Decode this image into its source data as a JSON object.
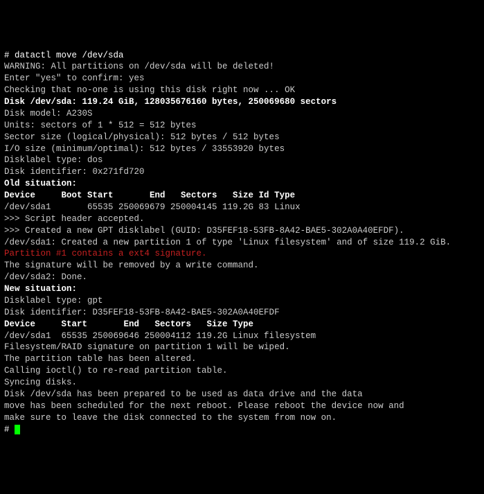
{
  "lines": [
    {
      "text": "# datactl move /dev/sda",
      "cls": "white"
    },
    {
      "text": "WARNING: All partitions on /dev/sda will be deleted!",
      "cls": ""
    },
    {
      "text": "Enter \"yes\" to confirm: yes",
      "cls": ""
    },
    {
      "text": "Checking that no-one is using this disk right now ... OK",
      "cls": ""
    },
    {
      "text": "",
      "cls": ""
    },
    {
      "text": "Disk /dev/sda: 119.24 GiB, 128035676160 bytes, 250069680 sectors",
      "cls": "white bold"
    },
    {
      "text": "Disk model: A230S",
      "cls": ""
    },
    {
      "text": "Units: sectors of 1 * 512 = 512 bytes",
      "cls": ""
    },
    {
      "text": "Sector size (logical/physical): 512 bytes / 512 bytes",
      "cls": ""
    },
    {
      "text": "I/O size (minimum/optimal): 512 bytes / 33553920 bytes",
      "cls": ""
    },
    {
      "text": "Disklabel type: dos",
      "cls": ""
    },
    {
      "text": "Disk identifier: 0x271fd720",
      "cls": ""
    },
    {
      "text": "",
      "cls": ""
    },
    {
      "text": "Old situation:",
      "cls": "white bold"
    },
    {
      "text": "",
      "cls": ""
    },
    {
      "text": "Device     Boot Start       End   Sectors   Size Id Type",
      "cls": "white bold"
    },
    {
      "text": "/dev/sda1       65535 250069679 250004145 119.2G 83 Linux",
      "cls": ""
    },
    {
      "text": "",
      "cls": ""
    },
    {
      "text": ">>> Script header accepted.",
      "cls": ""
    },
    {
      "text": ">>> Created a new GPT disklabel (GUID: D35FEF18-53FB-8A42-BAE5-302A0A40EFDF).",
      "cls": ""
    },
    {
      "text": "/dev/sda1: Created a new partition 1 of type 'Linux filesystem' and of size 119.2 GiB.",
      "cls": ""
    },
    {
      "text": "Partition #1 contains a ext4 signature.",
      "cls": "red"
    },
    {
      "text": "The signature will be removed by a write command.",
      "cls": ""
    },
    {
      "text": "/dev/sda2: Done.",
      "cls": ""
    },
    {
      "text": "",
      "cls": ""
    },
    {
      "text": "New situation:",
      "cls": "white bold"
    },
    {
      "text": "Disklabel type: gpt",
      "cls": ""
    },
    {
      "text": "Disk identifier: D35FEF18-53FB-8A42-BAE5-302A0A40EFDF",
      "cls": ""
    },
    {
      "text": "",
      "cls": ""
    },
    {
      "text": "Device     Start       End   Sectors   Size Type",
      "cls": "white bold"
    },
    {
      "text": "/dev/sda1  65535 250069646 250004112 119.2G Linux filesystem",
      "cls": ""
    },
    {
      "text": "",
      "cls": ""
    },
    {
      "text": "Filesystem/RAID signature on partition 1 will be wiped.",
      "cls": ""
    },
    {
      "text": "",
      "cls": ""
    },
    {
      "text": "The partition table has been altered.",
      "cls": ""
    },
    {
      "text": "Calling ioctl() to re-read partition table.",
      "cls": ""
    },
    {
      "text": "Syncing disks.",
      "cls": ""
    },
    {
      "text": "",
      "cls": ""
    },
    {
      "text": "Disk /dev/sda has been prepared to be used as data drive and the data",
      "cls": ""
    },
    {
      "text": "move has been scheduled for the next reboot. Please reboot the device now and",
      "cls": ""
    },
    {
      "text": "make sure to leave the disk connected to the system from now on.",
      "cls": ""
    }
  ],
  "prompt": "# "
}
